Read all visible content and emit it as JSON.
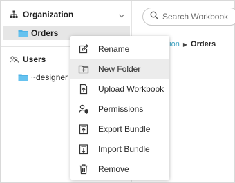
{
  "sidebar": {
    "organization": {
      "label": "Organization"
    },
    "orders": {
      "label": "Orders"
    },
    "users": {
      "label": "Users"
    },
    "designer": {
      "label": "~designer"
    }
  },
  "search": {
    "placeholder": "Search Workbook"
  },
  "breadcrumb": {
    "parent": "ation",
    "current": "Orders"
  },
  "context_menu": {
    "items": [
      {
        "label": "Rename",
        "icon": "edit-icon"
      },
      {
        "label": "New Folder",
        "icon": "new-folder-icon",
        "highlighted": true
      },
      {
        "label": "Upload Workbook",
        "icon": "upload-icon"
      },
      {
        "label": "Permissions",
        "icon": "permissions-icon"
      },
      {
        "label": "Export Bundle",
        "icon": "export-icon"
      },
      {
        "label": "Import Bundle",
        "icon": "import-icon"
      },
      {
        "label": "Remove",
        "icon": "trash-icon"
      }
    ]
  },
  "colors": {
    "folder": "#4fb3e6",
    "link": "#3fa3c2",
    "selected_row": "#e6e6e6",
    "hover_row": "#ececec"
  }
}
